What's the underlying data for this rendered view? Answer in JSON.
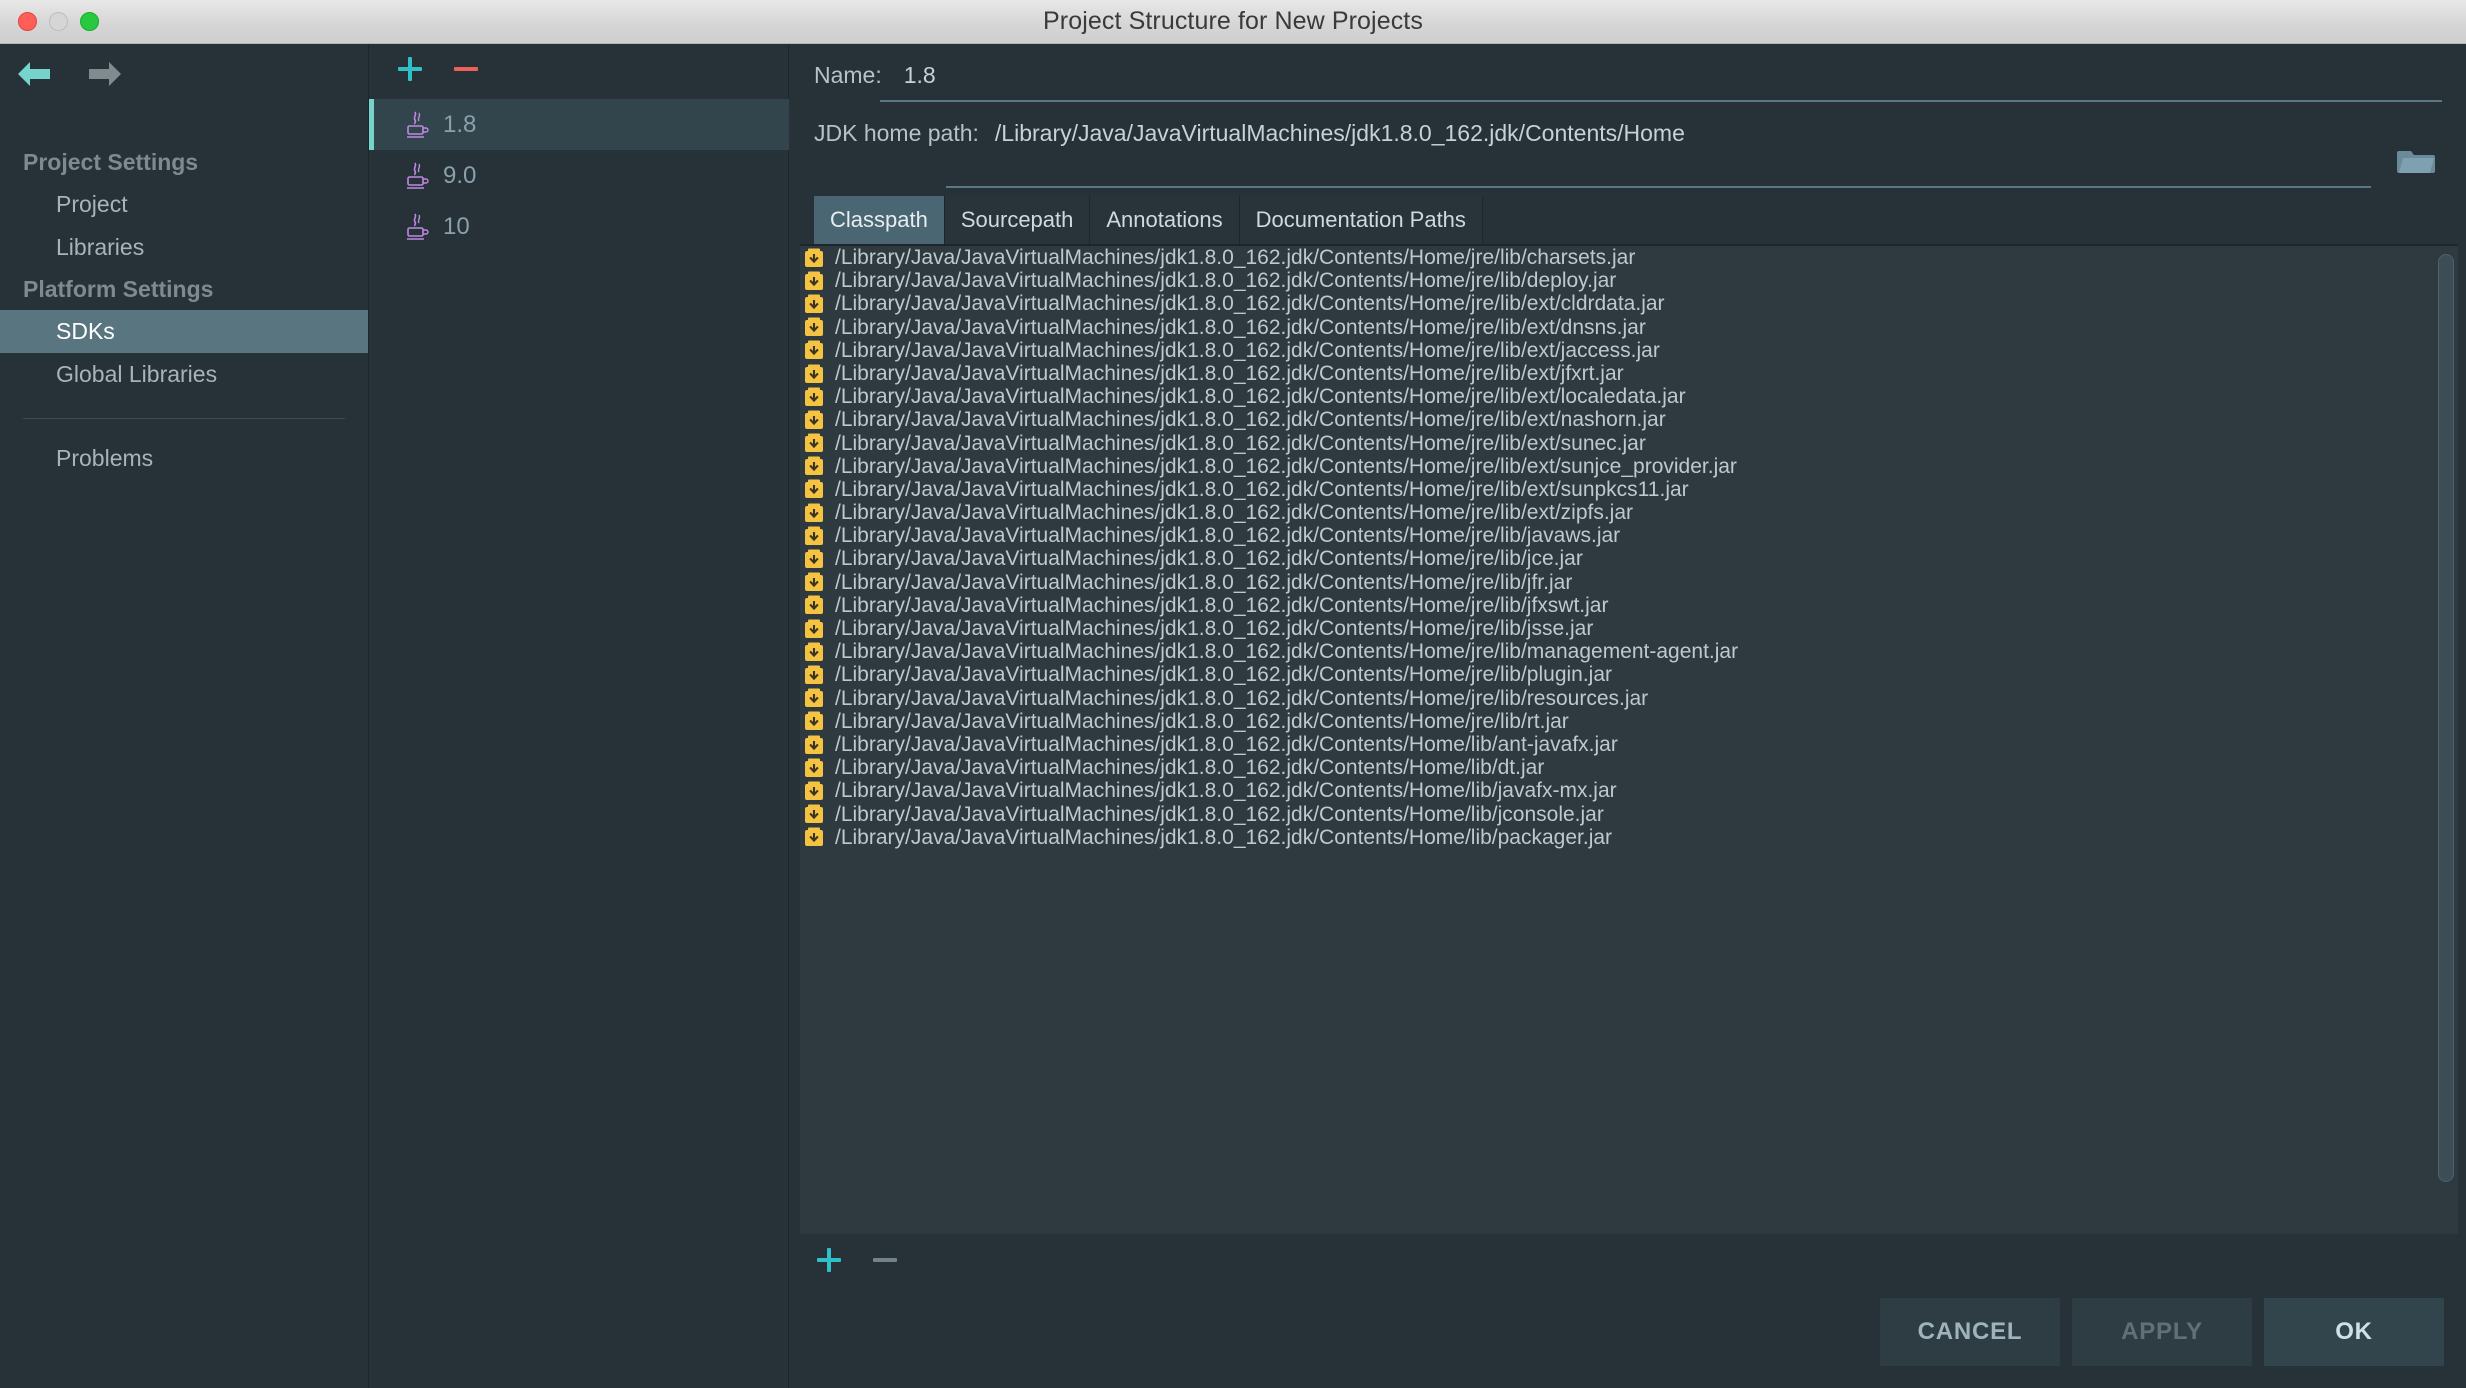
{
  "window": {
    "title": "Project Structure for New Projects",
    "traffic_lights": [
      "close-button",
      "minimize-button",
      "zoom-button"
    ]
  },
  "nav": {
    "back_icon": "back-arrow-icon",
    "forward_icon": "forward-arrow-icon"
  },
  "sidebar": {
    "groups": [
      {
        "label": "Project Settings",
        "items": [
          "Project",
          "Libraries"
        ]
      },
      {
        "label": "Platform Settings",
        "items": [
          "SDKs",
          "Global Libraries"
        ]
      }
    ],
    "group1_label": "Project Settings",
    "group1_item1": "Project",
    "group1_item2": "Libraries",
    "group2_label": "Platform Settings",
    "group2_item1": "SDKs",
    "group2_item2": "Global Libraries",
    "problems_label": "Problems",
    "selected": "SDKs"
  },
  "sdk_panel": {
    "add_label": "+",
    "remove_label": "-",
    "items": [
      {
        "name": "1.8",
        "selected": true
      },
      {
        "name": "9.0",
        "selected": false
      },
      {
        "name": "10",
        "selected": false
      }
    ],
    "item0": "1.8",
    "item1": "9.0",
    "item2": "10"
  },
  "detail": {
    "name_label": "Name:",
    "name_value": "1.8",
    "jdk_home_label": "JDK home path:",
    "jdk_home_value": "/Library/Java/JavaVirtualMachines/jdk1.8.0_162.jdk/Contents/Home",
    "browse_icon": "folder-icon"
  },
  "tabs": {
    "items": [
      "Classpath",
      "Sourcepath",
      "Annotations",
      "Documentation Paths"
    ],
    "tab0": "Classpath",
    "tab1": "Sourcepath",
    "tab2": "Annotations",
    "tab3": "Documentation Paths",
    "active": "Classpath"
  },
  "classpath": {
    "entries": [
      "/Library/Java/JavaVirtualMachines/jdk1.8.0_162.jdk/Contents/Home/jre/lib/charsets.jar",
      "/Library/Java/JavaVirtualMachines/jdk1.8.0_162.jdk/Contents/Home/jre/lib/deploy.jar",
      "/Library/Java/JavaVirtualMachines/jdk1.8.0_162.jdk/Contents/Home/jre/lib/ext/cldrdata.jar",
      "/Library/Java/JavaVirtualMachines/jdk1.8.0_162.jdk/Contents/Home/jre/lib/ext/dnsns.jar",
      "/Library/Java/JavaVirtualMachines/jdk1.8.0_162.jdk/Contents/Home/jre/lib/ext/jaccess.jar",
      "/Library/Java/JavaVirtualMachines/jdk1.8.0_162.jdk/Contents/Home/jre/lib/ext/jfxrt.jar",
      "/Library/Java/JavaVirtualMachines/jdk1.8.0_162.jdk/Contents/Home/jre/lib/ext/localedata.jar",
      "/Library/Java/JavaVirtualMachines/jdk1.8.0_162.jdk/Contents/Home/jre/lib/ext/nashorn.jar",
      "/Library/Java/JavaVirtualMachines/jdk1.8.0_162.jdk/Contents/Home/jre/lib/ext/sunec.jar",
      "/Library/Java/JavaVirtualMachines/jdk1.8.0_162.jdk/Contents/Home/jre/lib/ext/sunjce_provider.jar",
      "/Library/Java/JavaVirtualMachines/jdk1.8.0_162.jdk/Contents/Home/jre/lib/ext/sunpkcs11.jar",
      "/Library/Java/JavaVirtualMachines/jdk1.8.0_162.jdk/Contents/Home/jre/lib/ext/zipfs.jar",
      "/Library/Java/JavaVirtualMachines/jdk1.8.0_162.jdk/Contents/Home/jre/lib/javaws.jar",
      "/Library/Java/JavaVirtualMachines/jdk1.8.0_162.jdk/Contents/Home/jre/lib/jce.jar",
      "/Library/Java/JavaVirtualMachines/jdk1.8.0_162.jdk/Contents/Home/jre/lib/jfr.jar",
      "/Library/Java/JavaVirtualMachines/jdk1.8.0_162.jdk/Contents/Home/jre/lib/jfxswt.jar",
      "/Library/Java/JavaVirtualMachines/jdk1.8.0_162.jdk/Contents/Home/jre/lib/jsse.jar",
      "/Library/Java/JavaVirtualMachines/jdk1.8.0_162.jdk/Contents/Home/jre/lib/management-agent.jar",
      "/Library/Java/JavaVirtualMachines/jdk1.8.0_162.jdk/Contents/Home/jre/lib/plugin.jar",
      "/Library/Java/JavaVirtualMachines/jdk1.8.0_162.jdk/Contents/Home/jre/lib/resources.jar",
      "/Library/Java/JavaVirtualMachines/jdk1.8.0_162.jdk/Contents/Home/jre/lib/rt.jar",
      "/Library/Java/JavaVirtualMachines/jdk1.8.0_162.jdk/Contents/Home/lib/ant-javafx.jar",
      "/Library/Java/JavaVirtualMachines/jdk1.8.0_162.jdk/Contents/Home/lib/dt.jar",
      "/Library/Java/JavaVirtualMachines/jdk1.8.0_162.jdk/Contents/Home/lib/javafx-mx.jar",
      "/Library/Java/JavaVirtualMachines/jdk1.8.0_162.jdk/Contents/Home/lib/jconsole.jar",
      "/Library/Java/JavaVirtualMachines/jdk1.8.0_162.jdk/Contents/Home/lib/packager.jar"
    ],
    "add_label": "+",
    "remove_label": "-"
  },
  "dialog_buttons": {
    "cancel": "CANCEL",
    "apply": "APPLY",
    "ok": "OK",
    "apply_enabled": false
  },
  "colors": {
    "background": "#263238",
    "list_background": "#2e3a40",
    "selection": "#597580",
    "accent_teal": "#2fc0c8",
    "accent_remove": "#ec6159",
    "jar_icon": "#f5c342",
    "java_icon": "#c188e0"
  }
}
